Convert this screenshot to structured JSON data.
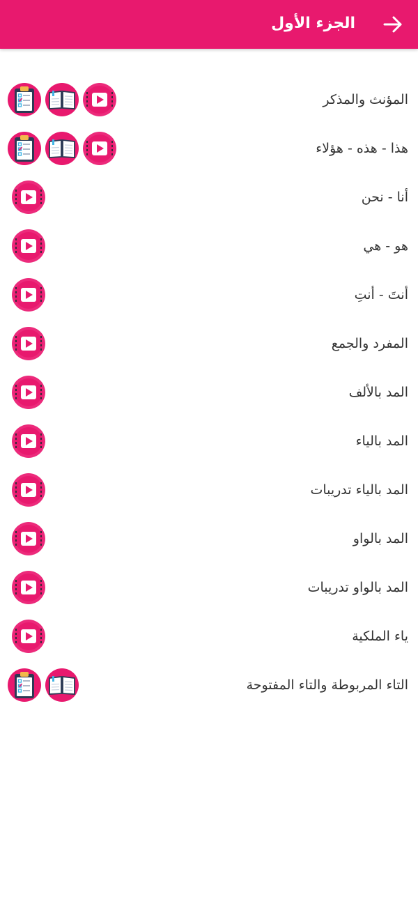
{
  "appbar": {
    "title": "الجزء الأول",
    "back_icon": "arrow-right-icon",
    "color": "#E8196E"
  },
  "lessons": [
    {
      "title": "المؤنث والمذكر",
      "icons": [
        "quiz",
        "book",
        "play"
      ]
    },
    {
      "title": "هذا - هذه - هؤلاء",
      "icons": [
        "quiz",
        "book",
        "play"
      ]
    },
    {
      "title": "أنا - نحن",
      "icons": [
        "play"
      ]
    },
    {
      "title": "هو - هي",
      "icons": [
        "play"
      ]
    },
    {
      "title": "أنتَ - أنتِ",
      "icons": [
        "play"
      ]
    },
    {
      "title": "المفرد والجمع",
      "icons": [
        "play"
      ]
    },
    {
      "title": "المد بالألف",
      "icons": [
        "play"
      ]
    },
    {
      "title": "المد بالياء",
      "icons": [
        "play"
      ]
    },
    {
      "title": "المد بالياء تدريبات",
      "icons": [
        "play"
      ]
    },
    {
      "title": "المد بالواو",
      "icons": [
        "play"
      ]
    },
    {
      "title": "المد بالواو تدريبات",
      "icons": [
        "play"
      ]
    },
    {
      "title": "ياء الملكية",
      "icons": [
        "play"
      ]
    },
    {
      "title": "التاء المربوطة والتاء المفتوحة",
      "icons": [
        "quiz",
        "book"
      ]
    }
  ],
  "icon_names": {
    "quiz": "quiz-clipboard-icon",
    "book": "open-book-icon",
    "play": "video-play-icon"
  },
  "colors": {
    "accent": "#E8196E",
    "text": "#333333"
  }
}
